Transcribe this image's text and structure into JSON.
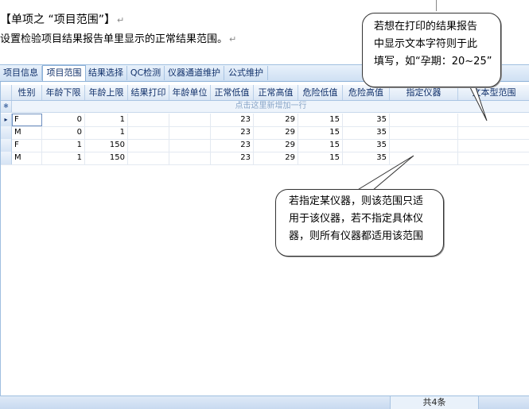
{
  "document": {
    "title": "【单项之 “项目范围”】",
    "description": "设置检验项目结果报告单里显示的正常结果范围。"
  },
  "tabs": [
    {
      "label": "项目信息",
      "active": false
    },
    {
      "label": "项目范围",
      "active": true
    },
    {
      "label": "结果选择",
      "active": false
    },
    {
      "label": "QC检测",
      "active": false
    },
    {
      "label": "仪器通道维护",
      "active": false
    },
    {
      "label": "公式维护",
      "active": false
    }
  ],
  "grid": {
    "columns": [
      "性别",
      "年龄下限",
      "年龄上限",
      "结果打印",
      "年龄单位",
      "正常低值",
      "正常高值",
      "危险低值",
      "危险高值",
      "指定仪器",
      "文本型范围"
    ],
    "new_row_text": "点击这里新增加一行",
    "rows": [
      {
        "sex": "F",
        "age_low": "0",
        "age_high": "1",
        "print": "",
        "age_unit": "",
        "normal_low": "23",
        "normal_high": "29",
        "danger_low": "15",
        "danger_high": "35",
        "instrument": "",
        "text_range": ""
      },
      {
        "sex": "M",
        "age_low": "0",
        "age_high": "1",
        "print": "",
        "age_unit": "",
        "normal_low": "23",
        "normal_high": "29",
        "danger_low": "15",
        "danger_high": "35",
        "instrument": "",
        "text_range": ""
      },
      {
        "sex": "F",
        "age_low": "1",
        "age_high": "150",
        "print": "",
        "age_unit": "",
        "normal_low": "23",
        "normal_high": "29",
        "danger_low": "15",
        "danger_high": "35",
        "instrument": "",
        "text_range": ""
      },
      {
        "sex": "M",
        "age_low": "1",
        "age_high": "150",
        "print": "",
        "age_unit": "",
        "normal_low": "23",
        "normal_high": "29",
        "danger_low": "15",
        "danger_high": "35",
        "instrument": "",
        "text_range": ""
      }
    ],
    "row_count": "共4条"
  },
  "callouts": {
    "top": [
      "若想在打印的结果报告",
      "中显示文本字符则于此",
      "填写，如“孕期：20~25”"
    ],
    "bottom": [
      "若指定某仪器，则该范围只适",
      "用于该仪器，若不指定具体仪",
      "器，则所有仪器都适用该范围"
    ]
  }
}
